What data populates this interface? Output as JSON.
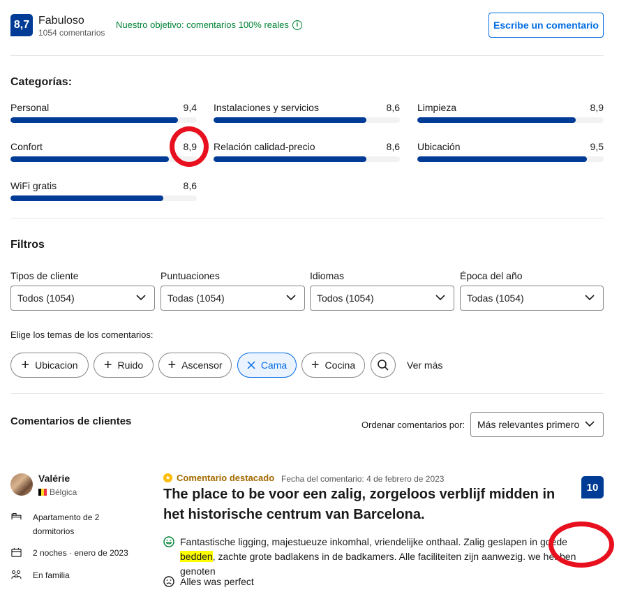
{
  "header": {
    "score": "8,7",
    "score_word": "Fabuloso",
    "review_count": "1054 comentarios",
    "objective": "Nuestro objetivo: comentarios 100% reales",
    "write_button": "Escribe un comentario"
  },
  "categories": {
    "title": "Categorías:",
    "items": [
      {
        "label": "Personal",
        "score": "9,4",
        "value": 9.4
      },
      {
        "label": "Instalaciones y servicios",
        "score": "8,6",
        "value": 8.6
      },
      {
        "label": "Limpieza",
        "score": "8,9",
        "value": 8.9
      },
      {
        "label": "Confort",
        "score": "8,9",
        "value": 8.9
      },
      {
        "label": "Relación calidad-precio",
        "score": "8,6",
        "value": 8.6
      },
      {
        "label": "Ubicación",
        "score": "9,5",
        "value": 9.5
      },
      {
        "label": "WiFi gratis",
        "score": "8,6",
        "value": 8.6
      }
    ]
  },
  "filters": {
    "title": "Filtros",
    "selects": [
      {
        "label": "Tipos de cliente",
        "value": "Todos (1054)"
      },
      {
        "label": "Puntuaciones",
        "value": "Todas (1054)"
      },
      {
        "label": "Idiomas",
        "value": "Todos (1054)"
      },
      {
        "label": "Época del año",
        "value": "Todas (1054)"
      }
    ],
    "themes_label": "Elige los temas de los comentarios:",
    "chips": [
      {
        "label": "Ubicacion",
        "active": false
      },
      {
        "label": "Ruido",
        "active": false
      },
      {
        "label": "Ascensor",
        "active": false
      },
      {
        "label": "Cama",
        "active": true
      },
      {
        "label": "Cocina",
        "active": false
      }
    ],
    "see_more": "Ver más"
  },
  "reviews": {
    "title": "Comentarios de clientes",
    "sort_label": "Ordenar comentarios por:",
    "sort_value": "Más relevantes primero",
    "items": [
      {
        "name": "Valérie",
        "country": "Bélgica",
        "room": "Apartamento de 2 dormitorios",
        "stay": "2 noches · enero de 2023",
        "traveler": "En familia",
        "featured": "Comentario destacado",
        "date": "Fecha del comentario: 4 de febrero de 2023",
        "score": "10",
        "title": "The place to be voor een zalig, zorgeloos verblijf midden in het historische centrum van Barcelona.",
        "positive_before": "Fantastische ligging, majestueuze inkomhal, vriendelijke onthaal. Zalig geslapen in goede ",
        "positive_highlight": "bedden",
        "positive_after": ", zachte grote badlakens in de badkamers. Alle faciliteiten zijn aanwezig. we hebben genoten",
        "negative": "Alles was perfect"
      }
    ]
  },
  "colors": {
    "brand": "#003b95",
    "link": "#006ce4",
    "success": "#008234",
    "annotation": "#e8101e",
    "highlight": "#ffff00"
  }
}
